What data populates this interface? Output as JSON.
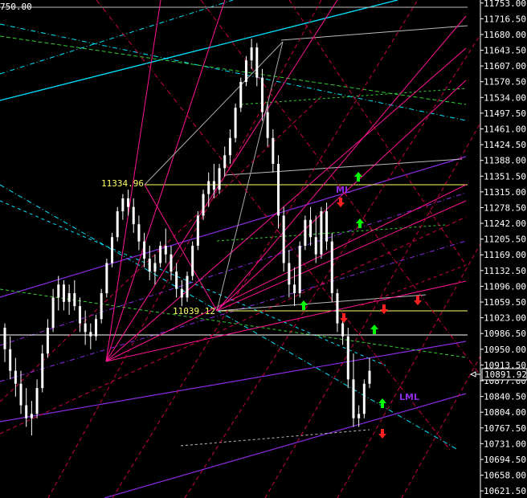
{
  "chart_data": {
    "type": "candlestick",
    "ylim": [
      10605,
      11760
    ],
    "price_axis": {
      "ticks": [
        "11753.00",
        "11716.50",
        "11680.00",
        "11643.50",
        "11607.00",
        "11570.50",
        "11534.00",
        "11497.50",
        "11461.00",
        "11424.50",
        "11388.00",
        "11351.50",
        "11315.00",
        "11278.50",
        "11242.00",
        "11205.50",
        "11169.00",
        "11132.50",
        "11096.00",
        "11059.50",
        "11023.00",
        "10986.50",
        "10950.00",
        "10913.50",
        "10877.00",
        "10840.50",
        "10804.00",
        "10767.50",
        "10731.00",
        "10694.50",
        "10658.00",
        "10621.50"
      ],
      "current_price_label": "10891.92",
      "current_price": 10891.92
    },
    "corner_label": "750.00",
    "annotations": [
      {
        "text": "11334.96",
        "price": 11334.96,
        "color": "#ffff66"
      },
      {
        "text": "11039.12",
        "price": 11039.12,
        "color": "#ffff66"
      },
      {
        "text": "ML",
        "color": "#8a2be2"
      },
      {
        "text": "LML",
        "color": "#8a2be2"
      }
    ],
    "colors": {
      "candle": "#ffffff",
      "median_line": "#8a2be2",
      "fan": "#ff1493",
      "fib": "#cc0044",
      "cyan": "#00e5ff",
      "green": "#33cc33",
      "arrow_up": "#00ff00",
      "arrow_down": "#ff2020"
    },
    "candles": [
      [
        11000,
        11010,
        10920,
        10950
      ],
      [
        10950,
        10980,
        10880,
        10900
      ],
      [
        10900,
        10930,
        10840,
        10870
      ],
      [
        10870,
        10900,
        10800,
        10820
      ],
      [
        10820,
        10860,
        10770,
        10790
      ],
      [
        10790,
        10830,
        10750,
        10800
      ],
      [
        10800,
        10880,
        10790,
        10860
      ],
      [
        10860,
        10960,
        10850,
        10940
      ],
      [
        10940,
        11020,
        10930,
        11000
      ],
      [
        11000,
        11090,
        10990,
        11070
      ],
      [
        11070,
        11120,
        11040,
        11100
      ],
      [
        11100,
        11110,
        11040,
        11060
      ],
      [
        11060,
        11100,
        11030,
        11080
      ],
      [
        11080,
        11110,
        11040,
        11050
      ],
      [
        11050,
        11070,
        10990,
        11010
      ],
      [
        11010,
        11040,
        10960,
        10990
      ],
      [
        10990,
        11010,
        10950,
        10980
      ],
      [
        10980,
        11030,
        10970,
        11020
      ],
      [
        11020,
        11090,
        11010,
        11080
      ],
      [
        11080,
        11160,
        11070,
        11150
      ],
      [
        11150,
        11220,
        11140,
        11210
      ],
      [
        11210,
        11280,
        11200,
        11270
      ],
      [
        11270,
        11310,
        11250,
        11300
      ],
      [
        11300,
        11320,
        11260,
        11280
      ],
      [
        11280,
        11300,
        11220,
        11240
      ],
      [
        11240,
        11260,
        11180,
        11200
      ],
      [
        11200,
        11220,
        11140,
        11160
      ],
      [
        11160,
        11190,
        11110,
        11130
      ],
      [
        11130,
        11170,
        11100,
        11150
      ],
      [
        11150,
        11200,
        11140,
        11190
      ],
      [
        11190,
        11230,
        11150,
        11170
      ],
      [
        11170,
        11190,
        11110,
        11130
      ],
      [
        11130,
        11150,
        11070,
        11090
      ],
      [
        11090,
        11110,
        11050,
        11070
      ],
      [
        11070,
        11130,
        11060,
        11120
      ],
      [
        11120,
        11200,
        11110,
        11190
      ],
      [
        11190,
        11270,
        11180,
        11260
      ],
      [
        11260,
        11320,
        11250,
        11310
      ],
      [
        11310,
        11360,
        11280,
        11340
      ],
      [
        11340,
        11380,
        11300,
        11320
      ],
      [
        11320,
        11380,
        11310,
        11370
      ],
      [
        11370,
        11420,
        11350,
        11400
      ],
      [
        11400,
        11460,
        11380,
        11440
      ],
      [
        11440,
        11520,
        11430,
        11510
      ],
      [
        11510,
        11580,
        11500,
        11570
      ],
      [
        11570,
        11630,
        11560,
        11620
      ],
      [
        11620,
        11670,
        11600,
        11650
      ],
      [
        11650,
        11660,
        11560,
        11580
      ],
      [
        11580,
        11600,
        11480,
        11500
      ],
      [
        11500,
        11520,
        11420,
        11440
      ],
      [
        11440,
        11460,
        11360,
        11380
      ],
      [
        11380,
        11400,
        11230,
        11260
      ],
      [
        11260,
        11280,
        11130,
        11150
      ],
      [
        11150,
        11180,
        11070,
        11100
      ],
      [
        11100,
        11140,
        11050,
        11080
      ],
      [
        11080,
        11200,
        11070,
        11190
      ],
      [
        11190,
        11260,
        11180,
        11250
      ],
      [
        11250,
        11280,
        11190,
        11210
      ],
      [
        11210,
        11260,
        11150,
        11170
      ],
      [
        11170,
        11280,
        11160,
        11270
      ],
      [
        11270,
        11290,
        11180,
        11200
      ],
      [
        11200,
        11220,
        11060,
        11080
      ],
      [
        11080,
        11090,
        10990,
        11010
      ],
      [
        11010,
        11020,
        10960,
        10980
      ],
      [
        10980,
        11000,
        10860,
        10880
      ],
      [
        10880,
        10940,
        10770,
        10790
      ],
      [
        10790,
        10820,
        10770,
        10800
      ],
      [
        10800,
        10880,
        10790,
        10870
      ],
      [
        10870,
        10930,
        10860,
        10900
      ]
    ]
  }
}
